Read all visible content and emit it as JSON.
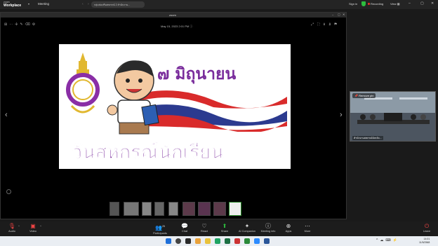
{
  "app": {
    "name_small": "zoom",
    "name_big": "Workplace"
  },
  "topbar": {
    "meeting_tab": "Meeting",
    "url": "กลุ่มส่งเสริมสหกรณ์ 2 สำนักงาน...",
    "sign_in": "Sign in",
    "recording": "Recording",
    "view": "View"
  },
  "share": {
    "title": "zoom",
    "date": "May 15, 2023 2:01 PM",
    "slide": {
      "title_line1": "๗ มิถุนายน",
      "title_line2": "วันสหกรณ์นักเรียน"
    }
  },
  "video": {
    "participant_name": "Remove pin",
    "caption": "สำนักงานสหกรณ์จังหวัด..."
  },
  "toolbar": {
    "audio": "Audio",
    "video": "Video",
    "participants": "Participants",
    "participants_count": "25",
    "chat": "Chat",
    "react": "React",
    "share": "Share",
    "ai_companion": "AI Companion",
    "meeting_info": "Meeting info",
    "apps": "Apps",
    "more": "More",
    "leave": "Leave"
  },
  "taskbar": {
    "time": "14:01",
    "date": "11/5/2568"
  },
  "colors": {
    "accent_purple": "#7a2d9c",
    "recording_red": "#e33333",
    "shield_green": "#2dbd3e"
  }
}
